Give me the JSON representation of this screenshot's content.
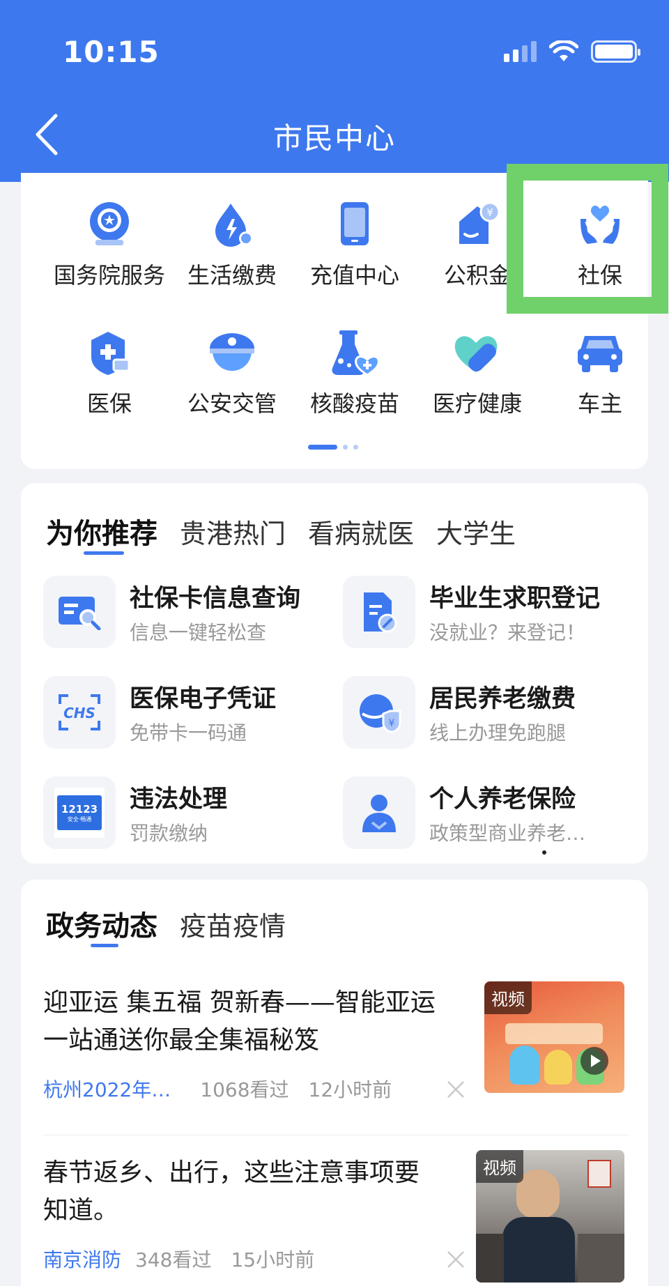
{
  "status_bar": {
    "time": "10:15"
  },
  "nav": {
    "title": "市民中心"
  },
  "services": [
    {
      "label": "国务院服务",
      "icon": "state-council-icon"
    },
    {
      "label": "生活缴费",
      "icon": "utility-payment-icon"
    },
    {
      "label": "充值中心",
      "icon": "phone-recharge-icon"
    },
    {
      "label": "公积金",
      "icon": "housing-fund-icon"
    },
    {
      "label": "社保",
      "icon": "social-security-icon"
    },
    {
      "label": "医保",
      "icon": "medical-insurance-icon"
    },
    {
      "label": "公安交管",
      "icon": "police-traffic-icon"
    },
    {
      "label": "核酸疫苗",
      "icon": "nucleic-acid-icon"
    },
    {
      "label": "医疗健康",
      "icon": "health-icon"
    },
    {
      "label": "车主",
      "icon": "car-owner-icon"
    }
  ],
  "recommend": {
    "tabs": [
      "为你推荐",
      "贵港热门",
      "看病就医",
      "大学生"
    ],
    "items": [
      {
        "title": "社保卡信息查询",
        "subtitle": "信息一键轻松查",
        "icon": "card-search-icon"
      },
      {
        "title": "毕业生求职登记",
        "subtitle": "没就业？来登记！",
        "icon": "document-edit-icon"
      },
      {
        "title": "医保电子凭证",
        "subtitle": "免带卡一码通",
        "icon": "chs-icon"
      },
      {
        "title": "居民养老缴费",
        "subtitle": "线上办理免跑腿",
        "icon": "pension-payment-icon"
      },
      {
        "title": "违法处理",
        "subtitle": "罚款缴纳",
        "icon": "traffic-12123-icon"
      },
      {
        "title": "个人养老保险",
        "subtitle": "政策型商业养老…",
        "icon": "person-insurance-icon"
      }
    ],
    "badge_12123": "12123",
    "badge_12123_sub": "安全·畅通"
  },
  "news": {
    "tabs": [
      "政务动态",
      "疫苗疫情"
    ],
    "items": [
      {
        "title": "迎亚运 集五福 贺新春——智能亚运一站通送你最全集福秘笈",
        "source": "杭州2022年…",
        "views": "1068看过",
        "time": "12小时前",
        "tag": "视频"
      },
      {
        "title": "春节返乡、出行，这些注意事项要知道。",
        "source": "南京消防",
        "views": "348看过",
        "time": "15小时前",
        "tag": "视频"
      }
    ]
  },
  "colors": {
    "brand": "#3e78ee",
    "highlight": "#70d06a",
    "background": "#f2f3f7"
  }
}
